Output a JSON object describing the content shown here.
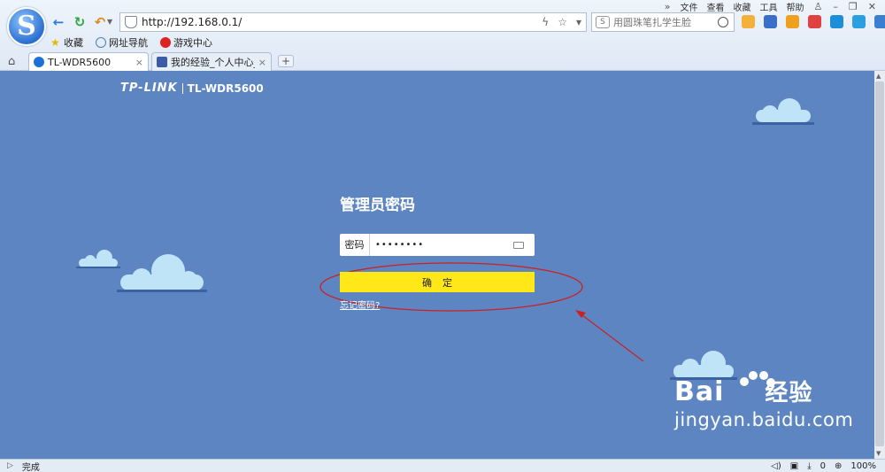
{
  "browser": {
    "top_menu": [
      "文件",
      "查看",
      "收藏",
      "工具",
      "帮助"
    ],
    "address": "http://192.168.0.1/",
    "search_placeholder": "用圆珠笔扎学生脸",
    "favorites": [
      {
        "icon": "star-icon",
        "label": "收藏"
      },
      {
        "icon": "globe-icon",
        "label": "网址导航"
      },
      {
        "icon": "game-icon",
        "label": "游戏中心"
      }
    ],
    "tabs": [
      {
        "label": "TL-WDR5600",
        "close": "×",
        "active": true
      },
      {
        "label": "我的经验_个人中心_百度",
        "close": "×",
        "active": false
      }
    ],
    "new_tab": "+"
  },
  "page": {
    "brand_logo": "TP-LINK",
    "brand_model": "TL-WDR5600",
    "title": "管理员密码",
    "password_label": "密码",
    "password_value": "••••••••",
    "confirm_label": "确定",
    "forgot_link": "忘记密码?"
  },
  "watermark": {
    "text_main": "Bai",
    "text_sub": "经验",
    "url": "jingyan.baidu.com"
  },
  "statusbar": {
    "status": "完成",
    "count": "0",
    "zoom": "100%"
  },
  "colors": {
    "page_bg": "#5c85c2",
    "confirm_bg": "#ffe718",
    "annotation": "#cc2020",
    "cloud": "#bfe3f7"
  }
}
